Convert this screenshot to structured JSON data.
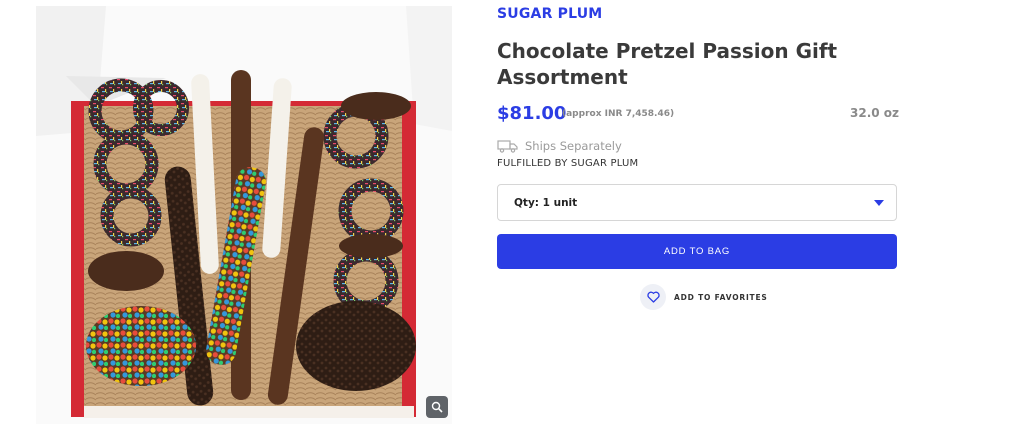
{
  "product": {
    "brand": "SUGAR PLUM",
    "title": "Chocolate Pretzel Passion Gift Assortment",
    "price": "$81.00",
    "approx_price": "(approx INR 7,458.46)",
    "weight": "32.0 oz",
    "ships_text": "Ships Separately",
    "fulfilled_text": "FULFILLED BY SUGAR PLUM"
  },
  "quantity": {
    "selected": "Qty: 1 unit"
  },
  "actions": {
    "add_to_bag": "ADD TO BAG",
    "add_to_favorites": "ADD TO FAVORITES"
  },
  "icons": {
    "zoom": "magnifier-icon",
    "truck": "truck-icon",
    "heart": "heart-icon",
    "dropdown": "caret-down-icon"
  },
  "colors": {
    "accent": "#2b3de4",
    "box_red": "#d42a35"
  }
}
